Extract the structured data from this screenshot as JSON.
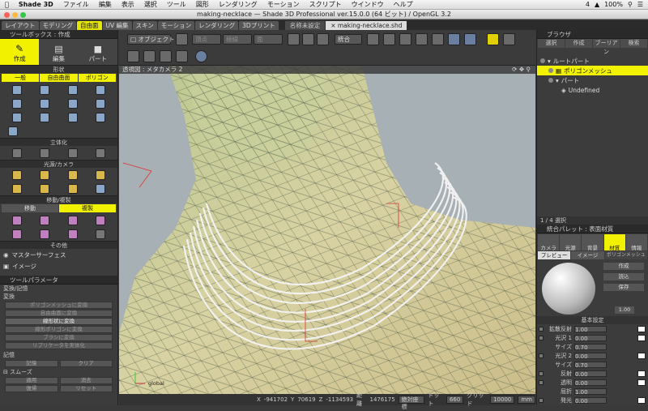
{
  "menubar": {
    "app": "Shade 3D",
    "items": [
      "ファイル",
      "編集",
      "表示",
      "選択",
      "ツール",
      "図形",
      "レンダリング",
      "モーション",
      "スクリプト",
      "ウインドウ",
      "ヘルプ"
    ],
    "status_items": [
      "4",
      "100%"
    ]
  },
  "window": {
    "title": "making-necklace — Shade 3D Professional ver.15.0.0 (64 ビット) / OpenGL 3.2"
  },
  "mode_tabs": [
    "レイアウト",
    "モデリング",
    "自由面",
    "UV 編集",
    "スキン",
    "モーション",
    "レンダリング",
    "3Dプリント"
  ],
  "mode_tab_active": 2,
  "doc_tabs": [
    "名称未設定",
    "making-necklace.shd"
  ],
  "doc_tab_active": 1,
  "toolbox": {
    "title": "ツールボックス : 作成",
    "big_tabs": [
      "作成",
      "編集",
      "パート"
    ],
    "shape_section": "形状",
    "shape_subtabs": [
      "一般",
      "自由曲面",
      "ポリゴン"
    ],
    "solid_section": "立体化",
    "light_section": "光源/カメラ",
    "move_section": "移動/複製",
    "move_subtabs": [
      "移動",
      "複製"
    ],
    "other_section": "その他",
    "master_surface": "マスターサーフェス",
    "image": "イメージ"
  },
  "tool_params": {
    "title": "ツールパラメータ",
    "section1": "変換/記憶",
    "sub1": "変換",
    "buttons": [
      "ポリゴンメッシュに変換",
      "自由曲面に変換",
      "線形状に変換",
      "線形ポリゴンに変換",
      "ブラシに変換",
      "リプリケータを実体化"
    ],
    "memory": "記憶",
    "mem_buttons": [
      "記憶",
      "クリア"
    ],
    "smooth": "スムーズ",
    "smooth_buttons": [
      "適用",
      "消去",
      "復帰",
      "リセット"
    ]
  },
  "toolbar": {
    "object_button": "オブジェクト",
    "dim1": "頂点",
    "dim2": "稜線",
    "dim3": "面",
    "integrate": "統合"
  },
  "viewport": {
    "header": "透視図 : メタカメラ 2",
    "axis_label": "global"
  },
  "browser": {
    "title": "ブラウザ",
    "tabs": [
      "選択",
      "作成",
      "ブーリアン",
      "検索"
    ],
    "tree": [
      {
        "label": "ルートパート",
        "selected": false
      },
      {
        "label": "ポリゴンメッシュ",
        "selected": true
      },
      {
        "label": "パート",
        "selected": false
      },
      {
        "label": "Undefined",
        "selected": false
      }
    ],
    "count": "1 / 4 選択"
  },
  "palette": {
    "title": "統合パレット : 表面材質",
    "tabs": [
      "カメラ",
      "光源",
      "背景",
      "材質",
      "情報"
    ],
    "preview_tabs": [
      "プレビュー",
      "イメージ"
    ],
    "poly_label": "ポリゴンメッシュ",
    "poly_buttons": [
      "作成",
      "読込",
      "保存"
    ],
    "basic": "基本設定",
    "rows": [
      "拡散反射",
      "光沢 1",
      "サイズ",
      "光沢 2",
      "サイズ",
      "反射",
      "透明",
      "屈折",
      "発光"
    ],
    "values": [
      "1.00",
      "0.00",
      "0.70",
      "0.00",
      "0.70",
      "0.00",
      "0.00",
      "1.00",
      "0.00"
    ],
    "opacity": "1.00"
  },
  "statusbar": {
    "x_label": "X",
    "x": "-941702",
    "y_label": "Y",
    "y": "70619",
    "z_label": "Z",
    "z": "-1134593",
    "dist_label": "距離",
    "dist": "1476175",
    "abs_label": "絶対座標",
    "dot_label": "ドット",
    "dot": "660",
    "grid_label": "グリッド",
    "grid": "10000",
    "unit": "mm"
  }
}
